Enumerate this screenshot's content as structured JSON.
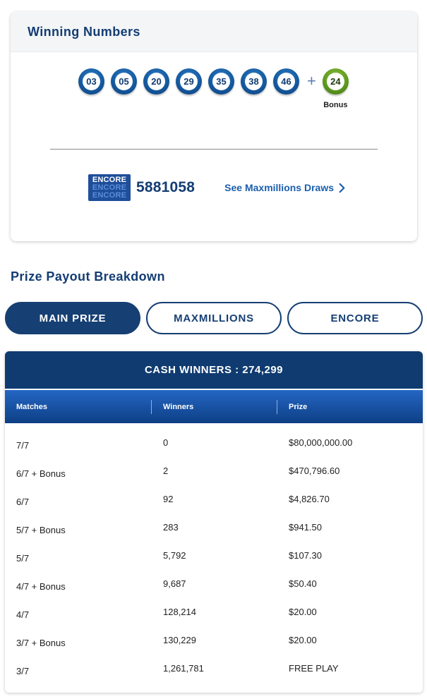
{
  "winning": {
    "title": "Winning Numbers",
    "numbers": [
      "03",
      "05",
      "20",
      "29",
      "35",
      "38",
      "46"
    ],
    "plus": "+",
    "bonus_number": "24",
    "bonus_label": "Bonus"
  },
  "encore": {
    "logo_text": [
      "ENCORE",
      "ENCORE",
      "ENCORE"
    ],
    "number": "5881058",
    "link_label": "See Maxmillions Draws"
  },
  "payout": {
    "title": "Prize Payout Breakdown",
    "tabs": [
      {
        "label": "MAIN PRIZE",
        "active": true
      },
      {
        "label": "MAXMILLIONS",
        "active": false
      },
      {
        "label": "ENCORE",
        "active": false
      }
    ],
    "cash_winners": "CASH WINNERS : 274,299",
    "columns": [
      "Matches",
      "Winners",
      "Prize"
    ],
    "rows": [
      {
        "matches": "7/7",
        "winners": "0",
        "prize": "$80,000,000.00"
      },
      {
        "matches": "6/7 + Bonus",
        "winners": "2",
        "prize": "$470,796.60"
      },
      {
        "matches": "6/7",
        "winners": "92",
        "prize": "$4,826.70"
      },
      {
        "matches": "5/7 + Bonus",
        "winners": "283",
        "prize": "$941.50"
      },
      {
        "matches": "5/7",
        "winners": "5,792",
        "prize": "$107.30"
      },
      {
        "matches": "4/7 + Bonus",
        "winners": "9,687",
        "prize": "$50.40"
      },
      {
        "matches": "4/7",
        "winners": "128,214",
        "prize": "$20.00"
      },
      {
        "matches": "3/7 + Bonus",
        "winners": "130,229",
        "prize": "$20.00"
      },
      {
        "matches": "3/7",
        "winners": "1,261,781",
        "prize": "FREE PLAY"
      }
    ]
  },
  "colors": {
    "navy": "#143d73",
    "ball_blue": "#155aa0",
    "bonus_green": "#5f9a1f",
    "link_blue": "#1b5fae"
  }
}
